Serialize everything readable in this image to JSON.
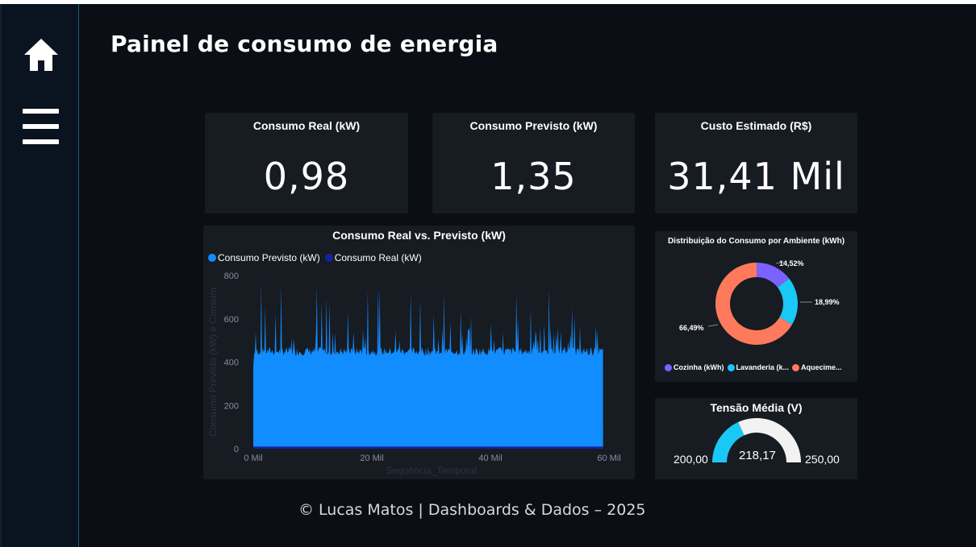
{
  "page": {
    "title": "Painel de consumo de energia",
    "footer": "© Lucas Matos | Dashboards & Dados – 2025"
  },
  "sidebar": {
    "items": [
      {
        "icon": "home-icon"
      },
      {
        "icon": "menu-icon"
      }
    ]
  },
  "kpis": [
    {
      "title": "Consumo Real (kW)",
      "value": "0,98"
    },
    {
      "title": "Consumo Previsto (kW)",
      "value": "1,35"
    },
    {
      "title": "Custo Estimado (R$)",
      "value": "31,41 Mil"
    }
  ],
  "colors": {
    "background": "#0b0e14",
    "card": "#171b22",
    "previsto": "#118dff",
    "real": "#12239e",
    "cozinha": "#7b61ff",
    "lavanderia": "#1ac8f5",
    "aquecimento": "#ff7a5c",
    "gauge_fill": "#1ac8f5",
    "gauge_rest": "#f2f2f2"
  },
  "chart_data": [
    {
      "type": "area",
      "title": "Consumo Real vs. Previsto (kW)",
      "xlabel": "Sequência_Temporal",
      "ylabel": "Consumo Previsto (kW) e Consum",
      "x_ticks": [
        "0 Mil",
        "20 Mil",
        "40 Mil",
        "60 Mil"
      ],
      "y_ticks": [
        "0",
        "200",
        "400",
        "600",
        "800"
      ],
      "xlim": [
        0,
        60000
      ],
      "ylim": [
        0,
        800
      ],
      "series": [
        {
          "name": "Consumo Previsto (kW)",
          "base_level": 440,
          "spike_max": 770
        },
        {
          "name": "Consumo Real (kW)",
          "base_level": 10
        }
      ],
      "x_extent": 59000
    },
    {
      "type": "pie",
      "title": "Distribuição do Consumo por Ambiente (kWh)",
      "slices": [
        {
          "name": "Cozinha (kWh)",
          "legend_label": "Cozinha (kWh)",
          "value": 14.52,
          "label": "14,52%"
        },
        {
          "name": "Lavanderia (kWh)",
          "legend_label": "Lavanderia (k...",
          "value": 18.99,
          "label": "18,99%"
        },
        {
          "name": "Aquecimento",
          "legend_label": "Aquecime...",
          "value": 66.49,
          "label": "66,49%"
        }
      ]
    },
    {
      "type": "gauge",
      "title": "Tensão Média (V)",
      "min": 200,
      "max": 250,
      "value": 218.17,
      "min_label": "200,00",
      "max_label": "250,00",
      "value_label": "218,17"
    }
  ]
}
